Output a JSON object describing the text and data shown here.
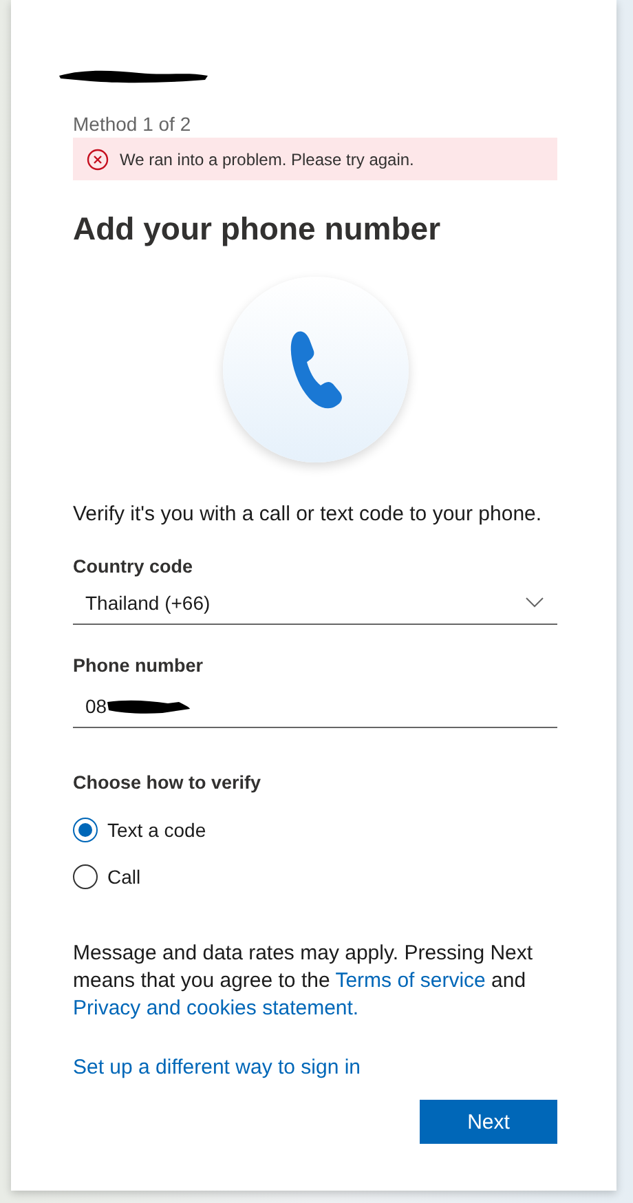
{
  "method_label": "Method 1 of 2",
  "error": {
    "message": "We ran into a problem. Please try again."
  },
  "title": "Add your phone number",
  "description": "Verify it's you with a call or text code to your phone.",
  "country": {
    "label": "Country code",
    "value": "Thailand (+66)"
  },
  "phone": {
    "label": "Phone number",
    "value": "08"
  },
  "verify": {
    "label": "Choose how to verify",
    "options": [
      {
        "label": "Text a code",
        "selected": true
      },
      {
        "label": "Call",
        "selected": false
      }
    ]
  },
  "notice": [
    {
      "kind": "text",
      "text": "Message and data rates may apply. Pressing Next means that you agree to the "
    },
    {
      "kind": "link",
      "text": "Terms of service"
    },
    {
      "kind": "text",
      "text": " and "
    },
    {
      "kind": "link",
      "text": "Privacy and cookies statement."
    }
  ],
  "alt_link": "Set up a different way to sign in",
  "next_button": "Next"
}
